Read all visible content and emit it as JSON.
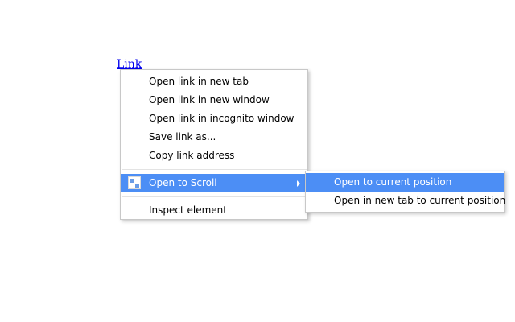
{
  "page": {
    "link_text": "Link"
  },
  "context_menu": {
    "items": [
      {
        "label": "Open link in new tab"
      },
      {
        "label": "Open link in new window"
      },
      {
        "label": "Open link in incognito window"
      },
      {
        "label": "Save link as..."
      },
      {
        "label": "Copy link address"
      },
      {
        "label": "Open to Scroll",
        "icon": "extension-icon",
        "has_submenu": true,
        "highlighted": true
      },
      {
        "label": "Inspect element"
      }
    ]
  },
  "submenu": {
    "items": [
      {
        "label": "Open to current position",
        "highlighted": true
      },
      {
        "label": "Open in new tab to current position"
      }
    ]
  },
  "colors": {
    "highlight": "#4c8ef5",
    "link": "#0000ee"
  }
}
